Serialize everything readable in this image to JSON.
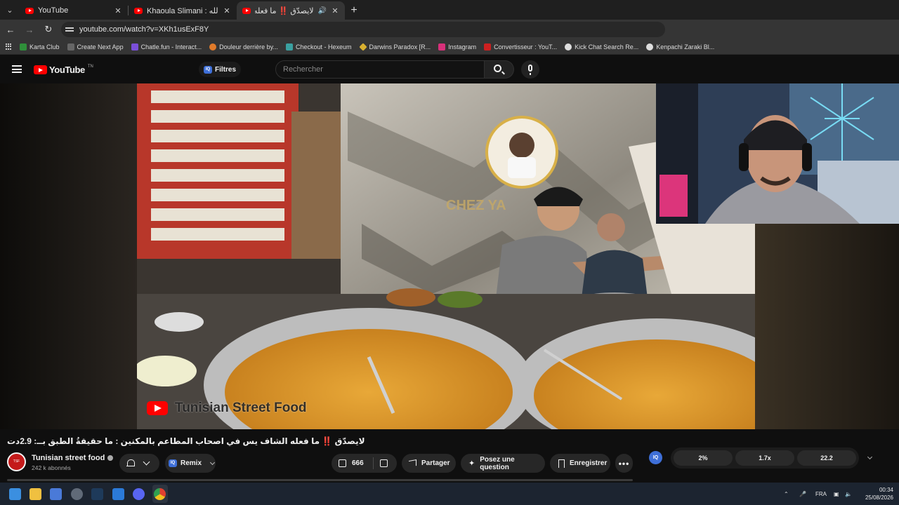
{
  "browser": {
    "tabs": [
      {
        "title": "YouTube",
        "active": false
      },
      {
        "title": "Khaoula Slimani : ء من أجل الله",
        "active": false
      },
      {
        "title": "لايصدّق ‼️ ما فعله الشاف يس",
        "active": true
      }
    ],
    "url": "youtube.com/watch?v=XKh1usExF8Y",
    "bookmarks": [
      {
        "label": "Karta Club",
        "color": "#2f8f3a"
      },
      {
        "label": "Create Next App",
        "color": "#666666"
      },
      {
        "label": "Chatle.fun - Interact...",
        "color": "#7a4fd8"
      },
      {
        "label": "Douleur derrière by...",
        "color": "#e07a2a"
      },
      {
        "label": "Checkout - Hexeum",
        "color": "#3aa0a0"
      },
      {
        "label": "Darwins Paradox [R...",
        "color": "#d8b030"
      },
      {
        "label": "Instagram",
        "color": "#d8307a"
      },
      {
        "label": "Convertisseur : YouT...",
        "color": "#cc2020"
      },
      {
        "label": "Kick Chat Search Re...",
        "color": "#dddddd"
      },
      {
        "label": "Kenpachi Zaraki Bl...",
        "color": "#dddddd"
      }
    ]
  },
  "youtube": {
    "logo_text": "YouTube",
    "logo_region": "TN",
    "filters_label": "Filtres",
    "iq_badge": "IQ",
    "search_placeholder": "Rechercher"
  },
  "video": {
    "watermark": "Tunisian Street Food",
    "title": "لايصدّق ‼️ ما فعله الشاف يس في اصحاب المطاعم بالمكنين : ما حقيقةُ الطبق بــ: 2.9دت",
    "channel": {
      "name": "Tunisian street food",
      "subscribers": "242 k abonnés",
      "verified": true
    },
    "actions": {
      "remix": "Remix",
      "likes": "666",
      "share": "Partager",
      "ask": "Posez une question",
      "save": "Enregistrer"
    },
    "iq_stats": {
      "badge": "IQ",
      "values": [
        "2%",
        "1.7x",
        "22.2"
      ]
    }
  },
  "taskbar": {
    "language": "FRA",
    "time": "00:34",
    "date": "25/08/2026"
  },
  "colors": {
    "youtube_red": "#ff0000",
    "page_bg": "#0f0f0f",
    "pill_bg": "#272727",
    "iq_blue": "#3e6fd8"
  }
}
